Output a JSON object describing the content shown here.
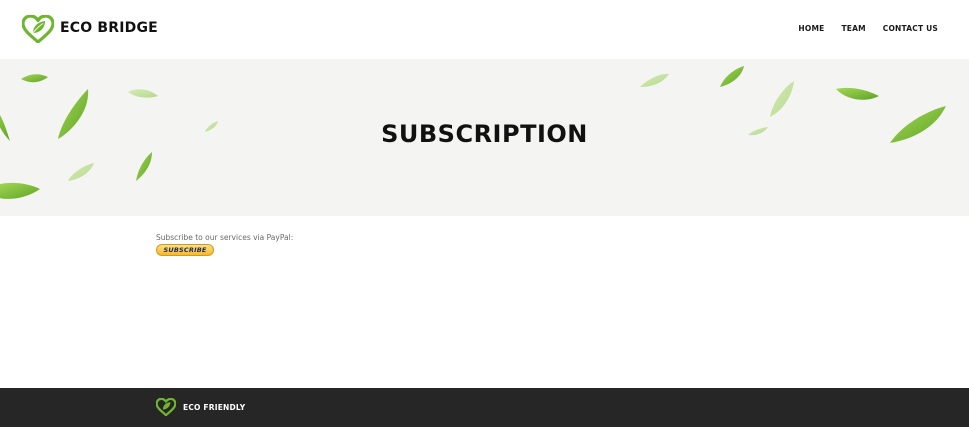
{
  "header": {
    "brand": "ECO BRIDGE",
    "logo_icon": "heart-leaf-icon",
    "nav": [
      {
        "label": "HOME"
      },
      {
        "label": "TEAM"
      },
      {
        "label": "CONTACT US"
      }
    ]
  },
  "hero": {
    "title": "SUBSCRIPTION",
    "decoration": "falling-leaves"
  },
  "content": {
    "text": "Subscribe to our services via PayPal:",
    "button_label": "SUBSCRIBE"
  },
  "footer": {
    "logo_icon": "heart-leaf-icon",
    "brand": "ECO FRIENDLY"
  },
  "colors": {
    "accent_green": "#6fb62f",
    "hero_bg": "#f4f4f2",
    "footer_bg": "#262626",
    "paypal_gold": "#f6b827"
  }
}
